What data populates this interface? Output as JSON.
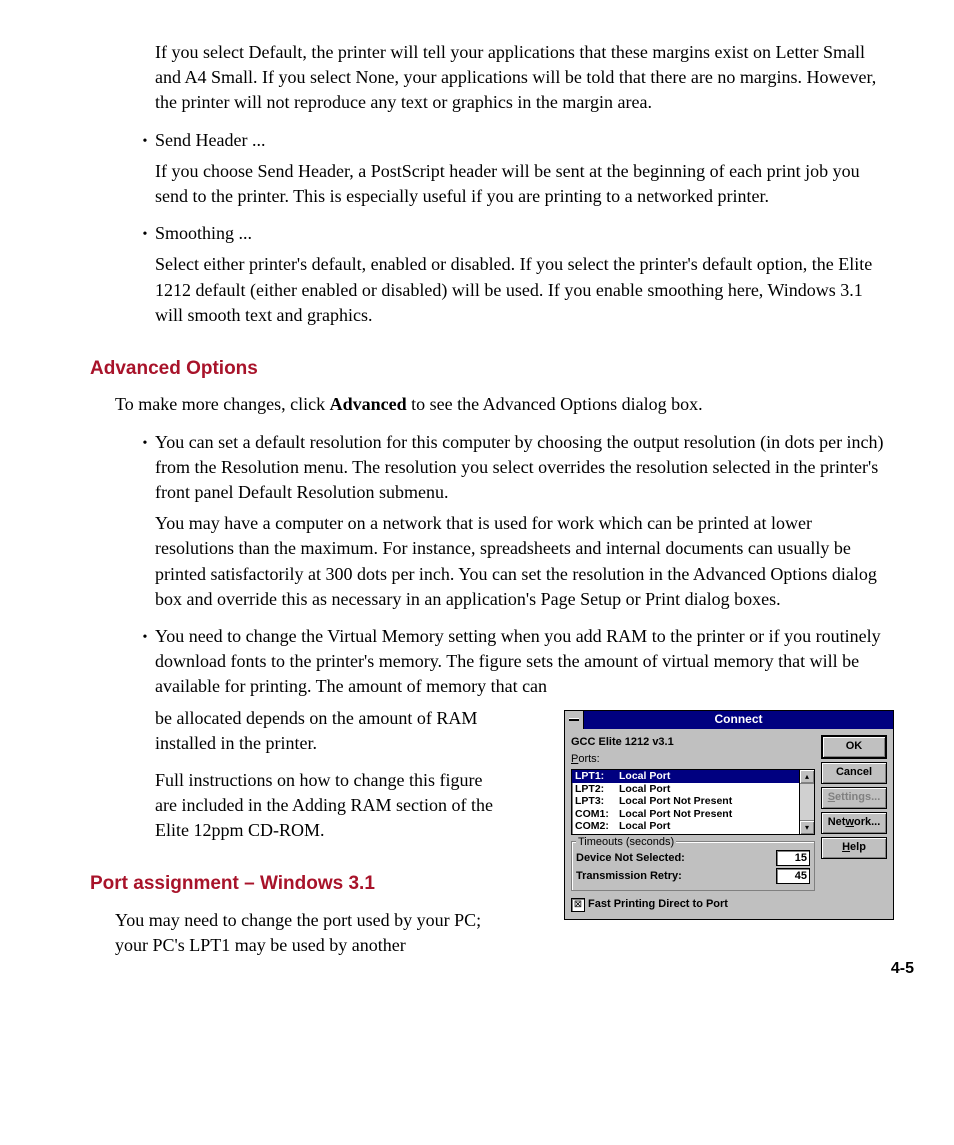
{
  "para_margins": "If you select Default, the printer will tell your applications that these margins exist on Letter Small and A4 Small. If you select None, your applications will be told that there are no margins. However, the printer will not reproduce any text or graphics in the margin area.",
  "b1": {
    "title": "Send Header ...",
    "body": "If you choose Send Header, a PostScript header will be sent at the beginning of each print job you send to the printer. This is especially useful if you are printing to a networked printer."
  },
  "b2": {
    "title": "Smoothing ...",
    "body": "Select either printer's default, enabled or disabled. If you select the printer's default option, the Elite 1212 default (either enabled or disabled) will be used. If you enable smoothing here, Windows 3.1 will smooth text and graphics."
  },
  "adv": {
    "heading": "Advanced Options",
    "intro_pre": "To make more changes, click ",
    "intro_bold": "Advanced",
    "intro_post": " to see the Advanced Options dialog box.",
    "res1": "You can set a default resolution for this computer by choosing the output resolution (in dots per inch) from the Resolution menu. The resolution you select overrides the resolution selected in the printer's front panel Default Resolution submenu.",
    "res2": "You may have a computer on a network that is used for work which can be printed at lower resolutions than the maximum. For instance, spreadsheets and internal documents can usually be printed satisfactorily at 300 dots per inch. You can set the resolution in the Advanced Options dialog box and override this as necessary in an application's Page Setup or Print dialog boxes.",
    "vm_full": "You need to change the Virtual Memory setting when you add RAM to the printer or if you routinely download fonts to the printer's memory. The figure sets the amount of virtual memory that will be available for printing. The amount of memory that can",
    "vm_tail": "be allocated depends on the amount of RAM installed in the printer.",
    "vm_instr": "Full instructions on how to change this figure are included in the Adding RAM section of the Elite 12ppm CD-ROM."
  },
  "port": {
    "heading": "Port assignment – Windows 3.1",
    "body": "You may need to change the port used by your PC; your PC's LPT1 may be used by another"
  },
  "dialog": {
    "title": "Connect",
    "printer": "GCC Elite 1212 v3.1",
    "ports_label": "Ports:",
    "items": [
      {
        "port": "LPT1:",
        "desc": "Local Port",
        "sel": true
      },
      {
        "port": "LPT2:",
        "desc": "Local Port",
        "sel": false
      },
      {
        "port": "LPT3:",
        "desc": "Local Port Not Present",
        "sel": false
      },
      {
        "port": "COM1:",
        "desc": "Local Port Not Present",
        "sel": false
      },
      {
        "port": "COM2:",
        "desc": "Local Port",
        "sel": false
      }
    ],
    "group": "Timeouts (seconds)",
    "dev_label": "Device Not Selected:",
    "dev_val": "15",
    "trans_label": "Transmission Retry:",
    "trans_val": "45",
    "fast": "Fast Printing Direct to Port",
    "buttons": {
      "ok": "OK",
      "cancel": "Cancel",
      "settings": "Settings...",
      "network": "Network...",
      "help": "Help"
    }
  },
  "page_num": "4-5"
}
